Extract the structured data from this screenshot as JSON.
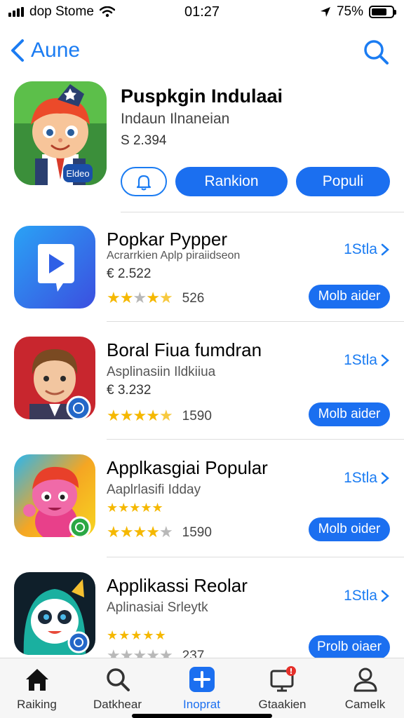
{
  "status": {
    "carrier": "dop Stome",
    "time": "01:27",
    "battery": "75%",
    "battery_level": 0.75,
    "icons": [
      "signal-icon",
      "wifi-icon",
      "location-arrow-icon",
      "battery-icon"
    ]
  },
  "nav": {
    "back_label": "Aune",
    "back_icon": "chevron-left-icon",
    "search_icon": "search-icon"
  },
  "hero": {
    "title": "Puspkgin Indulaai",
    "subtitle": "Indaun Ilnaneian",
    "price": "S 2.394",
    "badge": "Eldeo",
    "bell_icon": "bell-icon",
    "buttons": [
      "Rankion",
      "Populi"
    ]
  },
  "apps": [
    {
      "name": "Popkar Pypper",
      "category": "Acrarrkien Aplp piraiidseon",
      "price": "€ 2.522",
      "stars": [
        1,
        1,
        0,
        1,
        0.5
      ],
      "rating_count": "526",
      "rank": "1Stla",
      "button": "Molb aider",
      "icon": "play-icon"
    },
    {
      "name": "Boral Fiua fumdran",
      "category": "Asplinasiin Ildkiiua",
      "price": "€ 3.232",
      "stars": [
        1,
        1,
        1,
        1,
        0.5
      ],
      "rating_count": "1590",
      "rank": "1Stla",
      "button": "Molb aider",
      "icon": "boy-character-icon"
    },
    {
      "name": "Applkasgiai Popular",
      "category": "Aaplrlasifi Idday",
      "price": "★★★★★",
      "stars": [
        1,
        1,
        1,
        1,
        0
      ],
      "rating_count": "1590",
      "rank": "1Stla",
      "button": "Molb oider",
      "icon": "pink-character-icon"
    },
    {
      "name": "Applikassi Reolar",
      "category": "Aplinasiai Srleytk",
      "price": "★★★★★",
      "stars": [
        0,
        0,
        0,
        0,
        0
      ],
      "rating_count": "237",
      "rank": "1Stla",
      "button": "Prolb oiaer",
      "icon": "panda-character-icon"
    }
  ],
  "tabs": [
    {
      "label": "Raiking",
      "icon": "home-icon"
    },
    {
      "label": "Datkhear",
      "icon": "search-icon"
    },
    {
      "label": "Inoprat",
      "icon": "plus-icon"
    },
    {
      "label": "Gtaakien",
      "icon": "monitor-icon"
    },
    {
      "label": "Camelk",
      "icon": "person-icon"
    }
  ],
  "colors": {
    "accent": "#1b6ff0",
    "link": "#1b7cf2",
    "star": "#f5b800"
  }
}
